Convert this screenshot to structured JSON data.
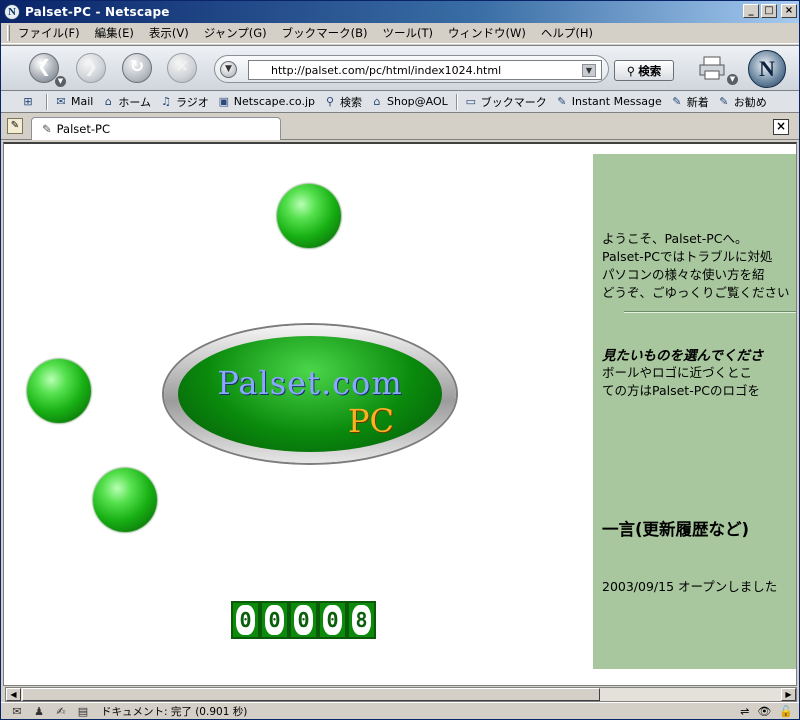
{
  "window": {
    "title": "Palset-PC - Netscape"
  },
  "menu": [
    "ファイル(F)",
    "編集(E)",
    "表示(V)",
    "ジャンプ(G)",
    "ブックマーク(B)",
    "ツール(T)",
    "ウィンドウ(W)",
    "ヘルプ(H)"
  ],
  "nav": {
    "url": "http://palset.com/pc/html/index1024.html",
    "search_label": "検索"
  },
  "bookmarks": [
    {
      "label": "Mail",
      "icon": "mail-icon",
      "glyph": "✉"
    },
    {
      "label": "ホーム",
      "icon": "home-icon",
      "glyph": "⌂"
    },
    {
      "label": "ラジオ",
      "icon": "radio-icon",
      "glyph": "♫"
    },
    {
      "label": "Netscape.co.jp",
      "icon": "my-netscape-icon",
      "glyph": "▣"
    },
    {
      "label": "検索",
      "icon": "search-icon",
      "glyph": "⚲"
    },
    {
      "label": "Shop@AOL",
      "icon": "shop-icon",
      "glyph": "⌂"
    },
    {
      "label": "ブックマーク",
      "icon": "bookmark-folder-icon",
      "glyph": "▭"
    },
    {
      "label": "Instant Message",
      "icon": "bookmark-item-icon",
      "glyph": "✎"
    },
    {
      "label": "新着",
      "icon": "bookmark-item-icon",
      "glyph": "✎"
    },
    {
      "label": "お勧め",
      "icon": "bookmark-item-icon",
      "glyph": "✎"
    }
  ],
  "tab": {
    "title": "Palset-PC"
  },
  "page": {
    "logo_line1": "Palset.com",
    "logo_line2": "PC",
    "counter": [
      "0",
      "0",
      "0",
      "0",
      "8"
    ],
    "welcome": [
      "ようこそ、Palset-PCへ。",
      "Palset-PCではトラブルに対処",
      "パソコンの様々な使い方を紹",
      "どうぞ、ごゆっくりご覧ください"
    ],
    "select_heading": "見たいものを選んでくださ",
    "select_body": [
      "ボールやロゴに近づくとこ",
      "ての方はPalset-PCのロゴを"
    ],
    "history_heading": "一言(更新履歴など)",
    "news": "2003/09/15 オープンしました"
  },
  "status": {
    "text": "ドキュメント: 完了 (0.901 秒)"
  }
}
